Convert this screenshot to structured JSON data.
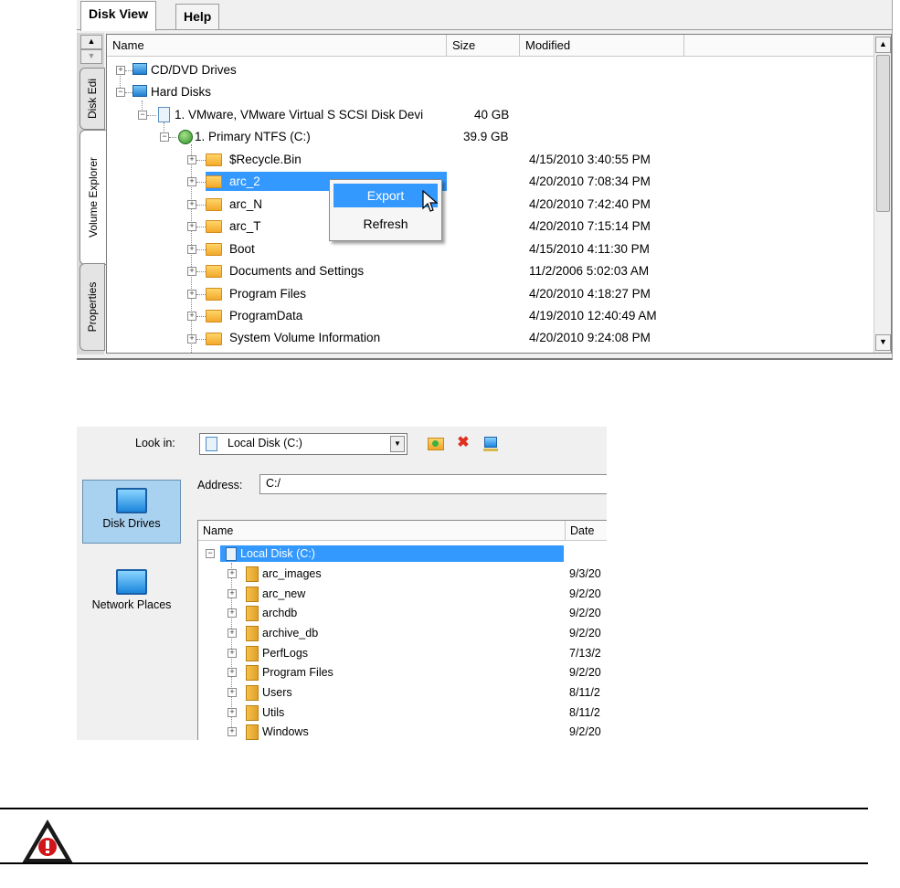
{
  "disk_view": {
    "tabs": [
      {
        "label": "Disk View",
        "active": true
      },
      {
        "label": "Help",
        "active": false
      }
    ],
    "side_tabs": [
      "Disk Edi",
      "Volume Explorer",
      "Properties"
    ],
    "columns": [
      "Name",
      "Size",
      "Modified"
    ],
    "rows": [
      {
        "name": "CD/DVD Drives",
        "size": "",
        "modified": ""
      },
      {
        "name": "Hard Disks",
        "size": "",
        "modified": ""
      },
      {
        "name": "1. VMware, VMware Virtual S SCSI Disk Devi",
        "size": "40 GB",
        "modified": ""
      },
      {
        "name": "1. Primary NTFS (C:)",
        "size": "39.9 GB",
        "modified": ""
      },
      {
        "name": "$Recycle.Bin",
        "size": "",
        "modified": "4/15/2010 3:40:55 PM"
      },
      {
        "name": "arc_2",
        "size": "",
        "modified": "4/20/2010 7:08:34 PM"
      },
      {
        "name": "arc_N",
        "size": "",
        "modified": "4/20/2010 7:42:40 PM"
      },
      {
        "name": "arc_T",
        "size": "",
        "modified": "4/20/2010 7:15:14 PM"
      },
      {
        "name": "Boot",
        "size": "",
        "modified": "4/15/2010 4:11:30 PM"
      },
      {
        "name": "Documents and Settings",
        "size": "",
        "modified": "11/2/2006 5:02:03 AM"
      },
      {
        "name": "Program Files",
        "size": "",
        "modified": "4/20/2010 4:18:27 PM"
      },
      {
        "name": "ProgramData",
        "size": "",
        "modified": "4/19/2010 12:40:49 AM"
      },
      {
        "name": "System Volume Information",
        "size": "",
        "modified": "4/20/2010 9:24:08 PM"
      }
    ],
    "context_menu": {
      "export": "Export",
      "refresh": "Refresh"
    }
  },
  "browser": {
    "look_in_label": "Look in:",
    "look_in_value": "Local Disk (C:)",
    "address_label": "Address:",
    "address_value": "C:/",
    "nav": [
      {
        "label": "Disk Drives",
        "selected": true
      },
      {
        "label": "Network Places",
        "selected": false
      }
    ],
    "columns": [
      "Name",
      "Date"
    ],
    "root": "Local Disk (C:)",
    "rows": [
      {
        "name": "arc_images",
        "date": "9/3/20"
      },
      {
        "name": "arc_new",
        "date": "9/2/20"
      },
      {
        "name": "archdb",
        "date": "9/2/20"
      },
      {
        "name": "archive_db",
        "date": "9/2/20"
      },
      {
        "name": "PerfLogs",
        "date": "7/13/2"
      },
      {
        "name": "Program Files",
        "date": "9/2/20"
      },
      {
        "name": "Users",
        "date": "8/11/2"
      },
      {
        "name": "Utils",
        "date": "8/11/2"
      },
      {
        "name": "Windows",
        "date": "9/2/20"
      }
    ]
  },
  "colors": {
    "selection": "#3399ff",
    "warning_red": "#d0161b"
  }
}
